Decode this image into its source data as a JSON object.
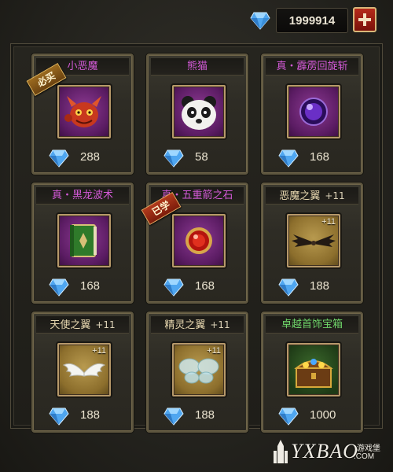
{
  "currency": {
    "icon": "diamond-icon",
    "amount": "1999914",
    "add_button_icon": "plus-icon"
  },
  "colors": {
    "title_magenta": "#d45ad8",
    "title_gold": "#e8d8b0",
    "title_green": "#6fd66a",
    "diamond_blue": "#6ec3ff"
  },
  "shop": {
    "items": [
      {
        "name": "小恶魔",
        "enhance": "",
        "price": "288",
        "title_color": "#d45ad8",
        "icon": "imp-icon",
        "ribbon": "必买"
      },
      {
        "name": "熊猫",
        "enhance": "",
        "price": "58",
        "title_color": "#d45ad8",
        "icon": "panda-icon",
        "ribbon": ""
      },
      {
        "name": "真・霹雳回旋斩",
        "enhance": "",
        "price": "168",
        "title_color": "#d45ad8",
        "icon": "orb-icon",
        "ribbon": ""
      },
      {
        "name": "真・黑龙波术",
        "enhance": "",
        "price": "168",
        "title_color": "#d45ad8",
        "icon": "spellbook-icon",
        "ribbon": ""
      },
      {
        "name": "真・五重箭之石",
        "enhance": "",
        "price": "168",
        "title_color": "#d45ad8",
        "icon": "red-gem-icon",
        "ribbon": "已学"
      },
      {
        "name": "恶魔之翼",
        "enhance": "+11",
        "price": "188",
        "title_color": "#e8d8b0",
        "icon": "demon-wings-icon",
        "ribbon": ""
      },
      {
        "name": "天使之翼",
        "enhance": "+11",
        "price": "188",
        "title_color": "#e8d8b0",
        "icon": "angel-wings-icon",
        "ribbon": ""
      },
      {
        "name": "精灵之翼",
        "enhance": "+11",
        "price": "188",
        "title_color": "#e8d8b0",
        "icon": "fairy-wings-icon",
        "ribbon": ""
      },
      {
        "name": "卓越首饰宝箱",
        "enhance": "",
        "price": "1000",
        "title_color": "#6fd66a",
        "icon": "treasure-chest-icon",
        "ribbon": ""
      }
    ]
  },
  "watermark": {
    "brand": "YXBAO",
    "sub_cn": "游戏堡",
    "sub_en": ".COM"
  }
}
